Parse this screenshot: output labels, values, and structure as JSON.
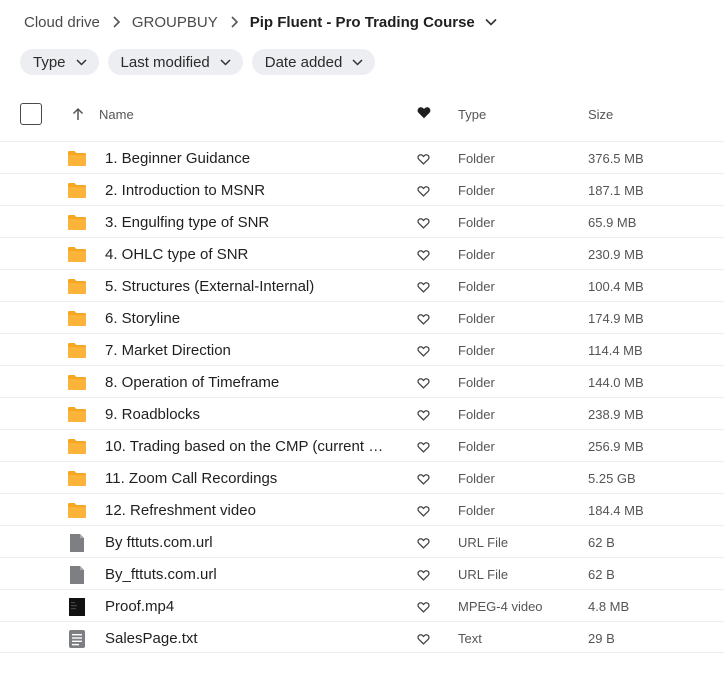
{
  "breadcrumb": {
    "items": [
      "Cloud drive",
      "GROUPBUY"
    ],
    "current": "Pip Fluent - Pro Trading Course"
  },
  "filters": [
    "Type",
    "Last modified",
    "Date added"
  ],
  "columns": {
    "name": "Name",
    "type": "Type",
    "size": "Size"
  },
  "colors": {
    "folder": "#f5a623",
    "file_gray": "#7d7f82",
    "video_dark": "#111111"
  },
  "files": [
    {
      "name": "1. Beginner Guidance",
      "type": "Folder",
      "size": "376.5 MB",
      "icon": "folder-icon"
    },
    {
      "name": "2. Introduction to MSNR",
      "type": "Folder",
      "size": "187.1 MB",
      "icon": "folder-icon"
    },
    {
      "name": "3. Engulfing type of SNR",
      "type": "Folder",
      "size": "65.9 MB",
      "icon": "folder-icon"
    },
    {
      "name": "4. OHLC type of SNR",
      "type": "Folder",
      "size": "230.9 MB",
      "icon": "folder-icon"
    },
    {
      "name": "5. Structures (External-Internal)",
      "type": "Folder",
      "size": "100.4 MB",
      "icon": "folder-icon"
    },
    {
      "name": "6. Storyline",
      "type": "Folder",
      "size": "174.9 MB",
      "icon": "folder-icon"
    },
    {
      "name": "7. Market Direction",
      "type": "Folder",
      "size": "114.4 MB",
      "icon": "folder-icon"
    },
    {
      "name": "8. Operation of Timeframe",
      "type": "Folder",
      "size": "144.0 MB",
      "icon": "folder-icon"
    },
    {
      "name": "9. Roadblocks",
      "type": "Folder",
      "size": "238.9 MB",
      "icon": "folder-icon"
    },
    {
      "name": "10. Trading based on the CMP (current m...",
      "type": "Folder",
      "size": "256.9 MB",
      "icon": "folder-icon"
    },
    {
      "name": "11. Zoom Call Recordings",
      "type": "Folder",
      "size": "5.25 GB",
      "icon": "folder-icon"
    },
    {
      "name": "12. Refreshment video",
      "type": "Folder",
      "size": "184.4 MB",
      "icon": "folder-icon"
    },
    {
      "name": "By fttuts.com.url",
      "type": "URL File",
      "size": "62 B",
      "icon": "url-file-icon"
    },
    {
      "name": "By_fttuts.com.url",
      "type": "URL File",
      "size": "62 B",
      "icon": "url-file-icon"
    },
    {
      "name": "Proof.mp4",
      "type": "MPEG-4 video",
      "size": "4.8 MB",
      "icon": "video-file-icon"
    },
    {
      "name": "SalesPage.txt",
      "type": "Text",
      "size": "29 B",
      "icon": "text-file-icon"
    }
  ]
}
